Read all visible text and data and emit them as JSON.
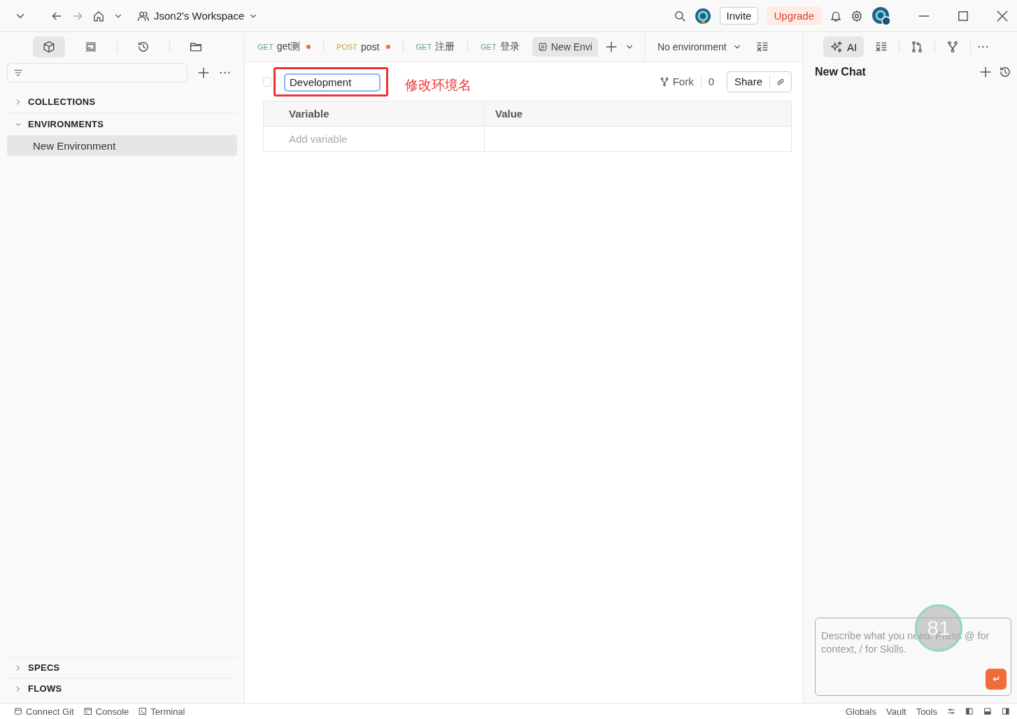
{
  "topbar": {
    "workspace": "Json2's Workspace",
    "invite": "Invite",
    "upgrade": "Upgrade"
  },
  "sidebar": {
    "tools": [
      {
        "kind": "cube",
        "selected": true
      },
      {
        "kind": "monitor",
        "selected": false
      },
      {
        "kind": "history",
        "selected": false
      },
      {
        "kind": "folder",
        "selected": false
      }
    ],
    "sections": [
      {
        "label": "COLLECTIONS",
        "expanded": false
      },
      {
        "label": "ENVIRONMENTS",
        "expanded": true,
        "children": [
          {
            "label": "New Environment",
            "selected": true
          }
        ]
      }
    ],
    "bottom_sections": [
      {
        "label": "SPECS",
        "expanded": false
      },
      {
        "label": "FLOWS",
        "expanded": false
      }
    ]
  },
  "tabs": [
    {
      "kind": "request",
      "method": "GET",
      "color": "#5e9e78",
      "label": "get测",
      "unsaved": true,
      "selected": false
    },
    {
      "kind": "request",
      "method": "POST",
      "color": "#c9a04a",
      "label": "post",
      "unsaved": true,
      "selected": false
    },
    {
      "kind": "request",
      "method": "GET",
      "color": "#5e9e78",
      "label": "注册",
      "unsaved": false,
      "selected": false
    },
    {
      "kind": "request",
      "method": "GET",
      "color": "#5e9e78",
      "label": "登录",
      "unsaved": false,
      "selected": false
    },
    {
      "kind": "environment",
      "label": "New Envi",
      "unsaved": false,
      "selected": true
    }
  ],
  "environment_select": "No environment",
  "editor": {
    "checked": false,
    "name": "Development",
    "annotation": "修改环境名",
    "fork": "Fork",
    "fork_count": "0",
    "share": "Share",
    "columns": [
      "Variable",
      "Value"
    ],
    "placeholder": "Add variable"
  },
  "ai_panel": {
    "tools": [
      {
        "kind": "ai",
        "label": "AI",
        "selected": true
      },
      {
        "kind": "variables",
        "selected": false
      },
      {
        "kind": "compare",
        "selected": false
      },
      {
        "kind": "fork",
        "selected": false
      },
      {
        "kind": "more",
        "selected": false
      }
    ],
    "title": "New Chat",
    "input_placeholder": "Describe what you need. Press @ for context, / for Skills.",
    "overlay": "81"
  },
  "status_bar": {
    "left": [
      {
        "kind": "git",
        "label": "Connect Git"
      },
      {
        "kind": "console",
        "label": "Console"
      },
      {
        "kind": "terminal",
        "label": "Terminal"
      }
    ],
    "right": [
      "Globals",
      "Vault",
      "Tools"
    ]
  }
}
